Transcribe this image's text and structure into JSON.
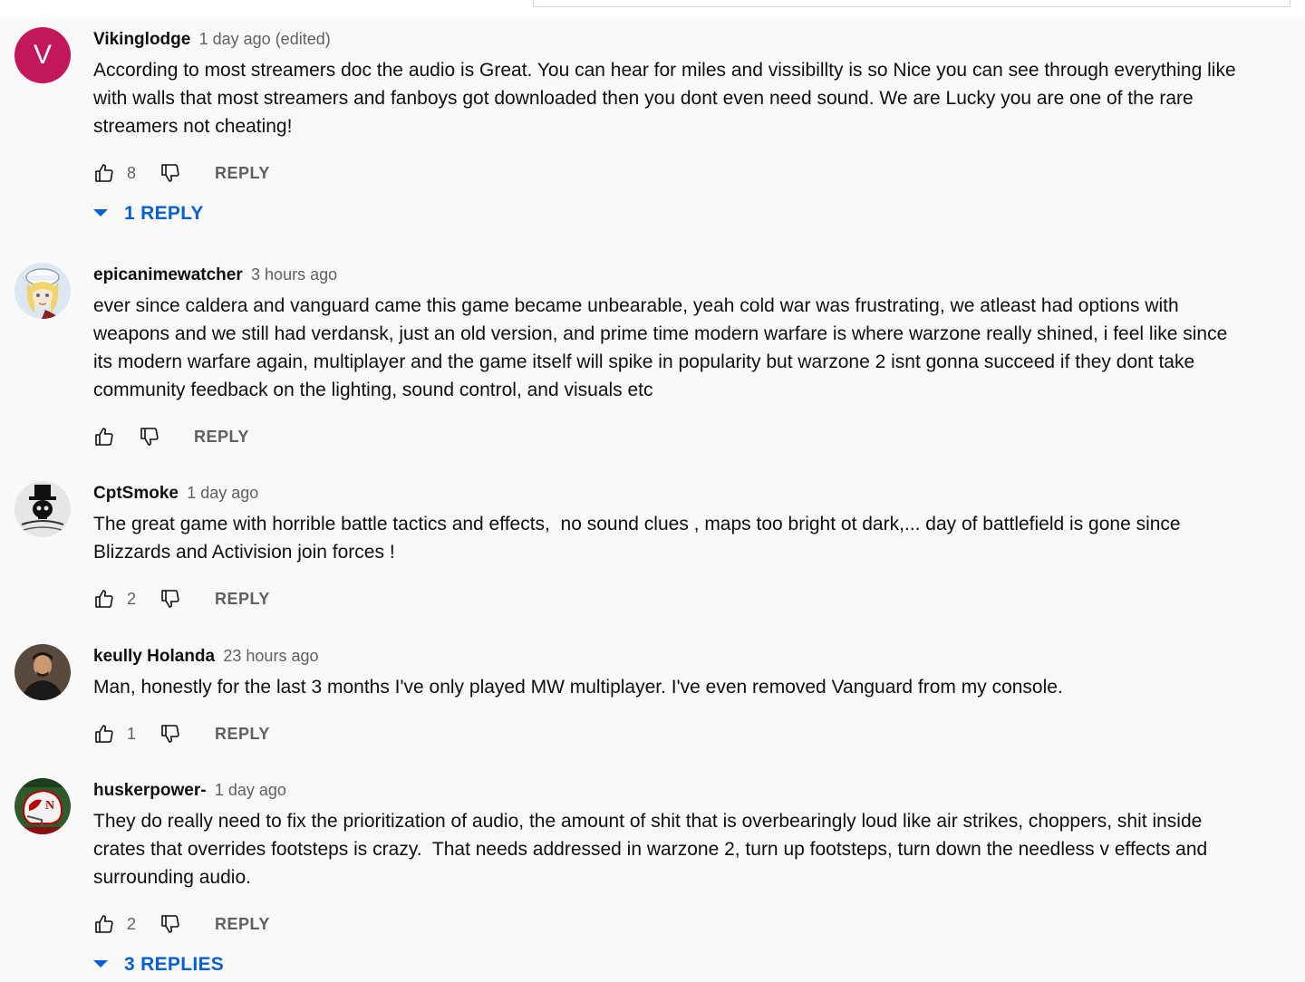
{
  "comments": [
    {
      "avatar_letter": "V",
      "avatar_color": "#c2185b",
      "author": "Vikinglodge",
      "time": "1 day ago (edited)",
      "text": "According to most streamers doc the audio is Great. You can hear for miles and vissibillty is so Nice you can see through everything like\nwith walls that most streamers and fanboys got downloaded then you dont even need sound. We are Lucky you are one of the rare\nstreamers not cheating!",
      "likes": "8",
      "reply_label": "REPLY",
      "replies_label": "1 REPLY"
    },
    {
      "avatar_icon": "anime-character-avatar-icon",
      "author": "epicanimewatcher",
      "time": "3 hours ago",
      "text": "ever since caldera and vanguard came this game became unbearable, yeah cold war was frustrating, we atleast had options with\nweapons and we still had verdansk, just an old version, and prime time modern warfare is where warzone really shined, i feel like since\nits modern warfare again, multiplayer and the game itself will spike in popularity but warzone 2 isnt gonna succeed if they dont take\ncommunity feedback on the lighting, sound control, and visuals etc",
      "likes": "",
      "reply_label": "REPLY"
    },
    {
      "avatar_icon": "skull-top-hat-avatar-icon",
      "author": "CptSmoke",
      "time": "1 day ago",
      "text": "The great game with horrible battle tactics and effects,  no sound clues , maps too bright ot dark,... day of battlefield is gone since\nBlizzards and Activision join forces !",
      "likes": "2",
      "reply_label": "REPLY"
    },
    {
      "avatar_icon": "person-photo-avatar-icon",
      "author": "keully Holanda",
      "time": "23 hours ago",
      "text": "Man, honestly for the last 3 months I've only played MW multiplayer. I've even removed Vanguard from my console.",
      "likes": "1",
      "reply_label": "REPLY"
    },
    {
      "avatar_icon": "football-helmet-avatar-icon",
      "author": "huskerpower-",
      "time": "1 day ago",
      "text": "They do really need to fix the prioritization of audio, the amount of shit that is overbearingly loud like air strikes, choppers, shit inside\ncrates that overrides footsteps is crazy.  That needs addressed in warzone 2, turn up footsteps, turn down the needless v effects and\nsurrounding audio.",
      "likes": "2",
      "reply_label": "REPLY",
      "replies_label": "3 REPLIES"
    }
  ],
  "colors": {
    "link_blue": "#065fd4",
    "secondary_text": "#606060",
    "background": "#f9f9f9"
  }
}
